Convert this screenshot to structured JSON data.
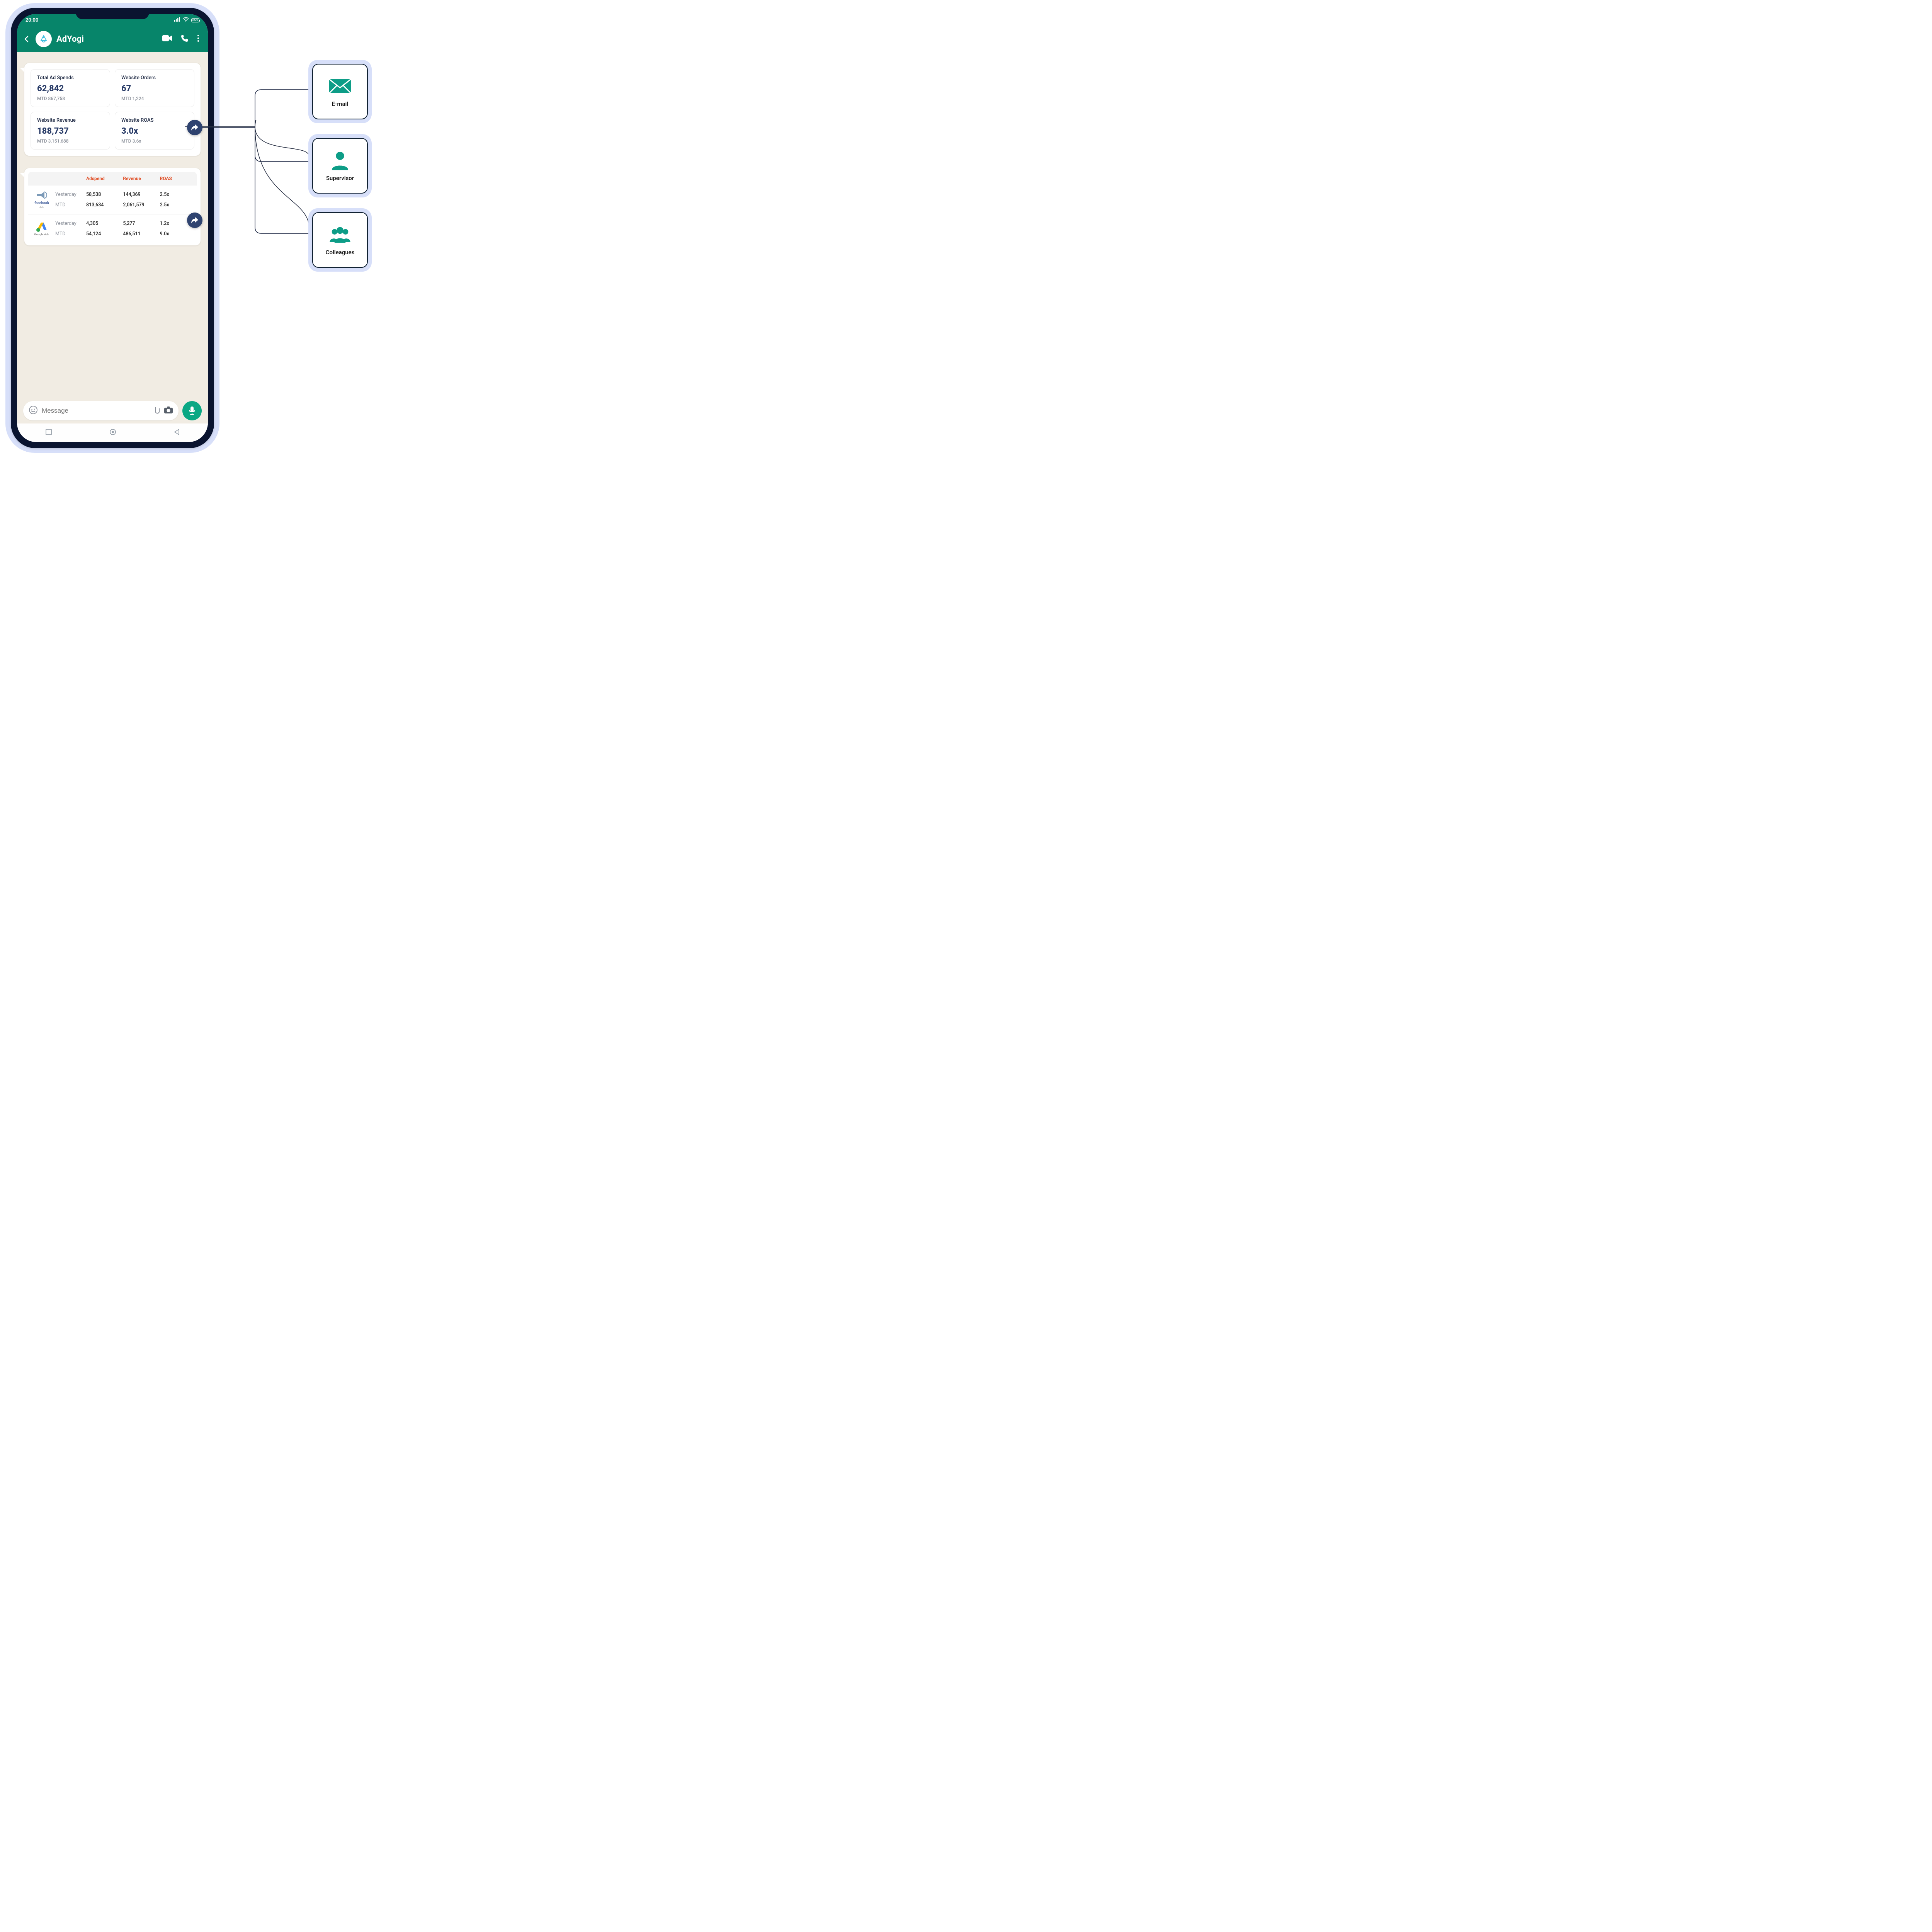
{
  "status": {
    "time": "20:00",
    "battery": "85%"
  },
  "chat": {
    "contact_name": "AdYogi",
    "kpis": [
      {
        "title": "Total Ad Spends",
        "value": "62,842",
        "mtd": "MTD 867,758"
      },
      {
        "title": "Website Orders",
        "value": "67",
        "mtd": "MTD 1,224"
      },
      {
        "title": "Website Revenue",
        "value": "188,737",
        "mtd": "MTD 3,151,688"
      },
      {
        "title": "Website ROAS",
        "value": "3.0x",
        "mtd": "MTD 3.6x"
      }
    ],
    "table": {
      "headers": {
        "c1": "Adspend",
        "c2": "Revenue",
        "c3": "ROAS"
      },
      "providers": [
        {
          "name": "facebook",
          "sub": "Ads",
          "yesterday_label": "Yesterday",
          "mtd_label": "MTD",
          "y_adspend": "58,538",
          "y_revenue": "144,369",
          "y_roas": "2.5x",
          "m_adspend": "813,634",
          "m_revenue": "2,061,579",
          "m_roas": "2.5x"
        },
        {
          "name": "Google Ads",
          "sub": "",
          "yesterday_label": "Yesterday",
          "mtd_label": "MTD",
          "y_adspend": "4,305",
          "y_revenue": "5,277",
          "y_roas": "1.2x",
          "m_adspend": "54,124",
          "m_revenue": "486,511",
          "m_roas": "9.0x"
        }
      ]
    },
    "composer_placeholder": "Message"
  },
  "share_targets": [
    {
      "label": "E-mail"
    },
    {
      "label": "Supervisor"
    },
    {
      "label": "Colleagues"
    }
  ]
}
